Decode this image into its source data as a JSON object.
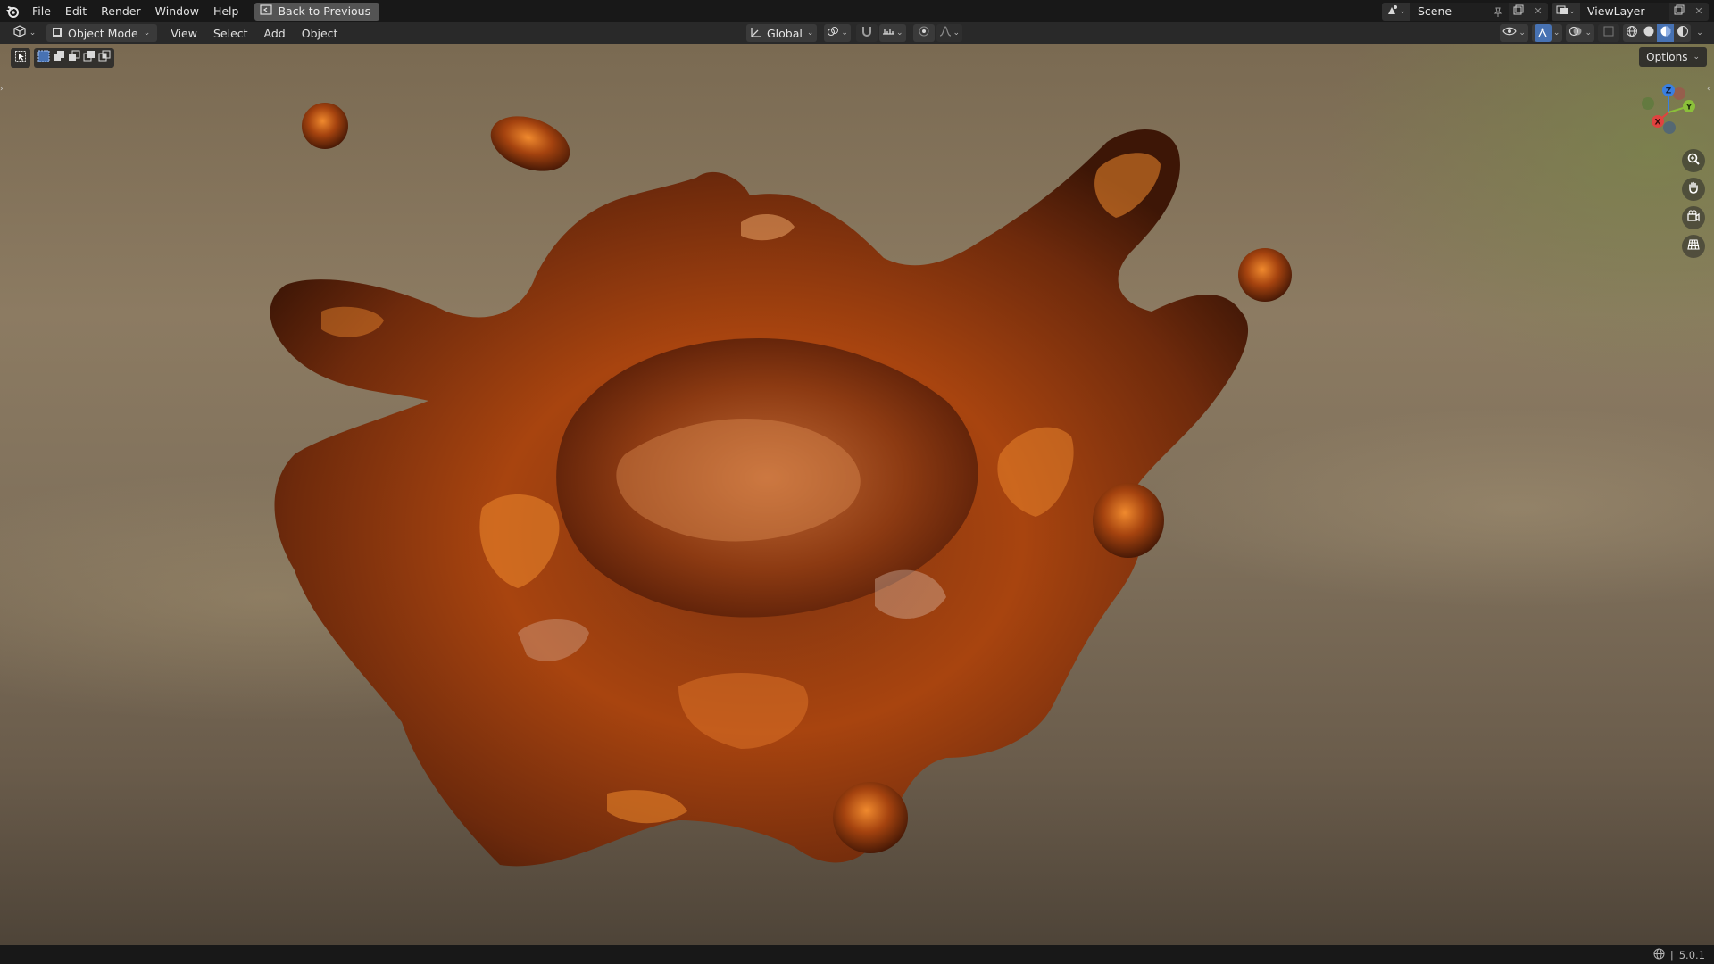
{
  "topbar": {
    "menus": [
      "File",
      "Edit",
      "Render",
      "Window",
      "Help"
    ],
    "back_label": "Back to Previous",
    "scene_name": "Scene",
    "view_layer_name": "ViewLayer"
  },
  "header": {
    "mode_label": "Object Mode",
    "menus": [
      "View",
      "Select",
      "Add",
      "Object"
    ],
    "transform_orientation": "Global",
    "shading_mode": "material-preview"
  },
  "viewport": {
    "options_label": "Options",
    "gizmo": {
      "x_label": "X",
      "y_label": "Y",
      "z_label": "Z"
    }
  },
  "statusbar": {
    "version": "5.0.1"
  },
  "colors": {
    "accent": "#4772b3",
    "axis_x": "#e0423f",
    "axis_y": "#8bc03a",
    "axis_z": "#3a7fe0",
    "splash_dark": "#5a1f08",
    "splash_mid": "#b24912",
    "splash_light": "#f08a2e"
  }
}
